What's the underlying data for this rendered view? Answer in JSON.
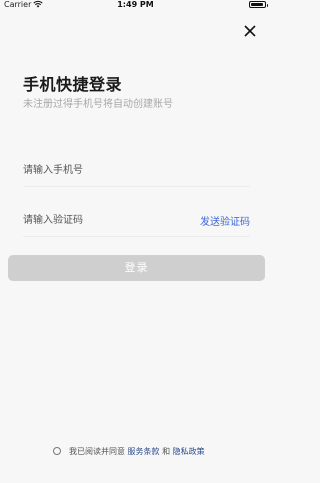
{
  "status_bar": {
    "carrier": "Carrier",
    "time": "1:49 PM"
  },
  "login": {
    "title": "手机快捷登录",
    "subtitle": "未注册过得手机号将自动创建账号",
    "phone_placeholder": "请输入手机号",
    "code_placeholder": "请输入验证码",
    "send_code": "发送验证码",
    "login_button": "登录"
  },
  "agreement": {
    "prefix": "我已阅读并同意",
    "terms": "服务条款",
    "and": "和",
    "privacy": "隐私政策"
  },
  "colors": {
    "accent": "#3b68d8",
    "button_disabled": "#cfcfcf",
    "background": "#f7f7f7"
  },
  "icons": {
    "close": "close-icon",
    "wifi": "wifi-icon",
    "battery": "battery-icon",
    "radio": "radio-unchecked-icon"
  }
}
